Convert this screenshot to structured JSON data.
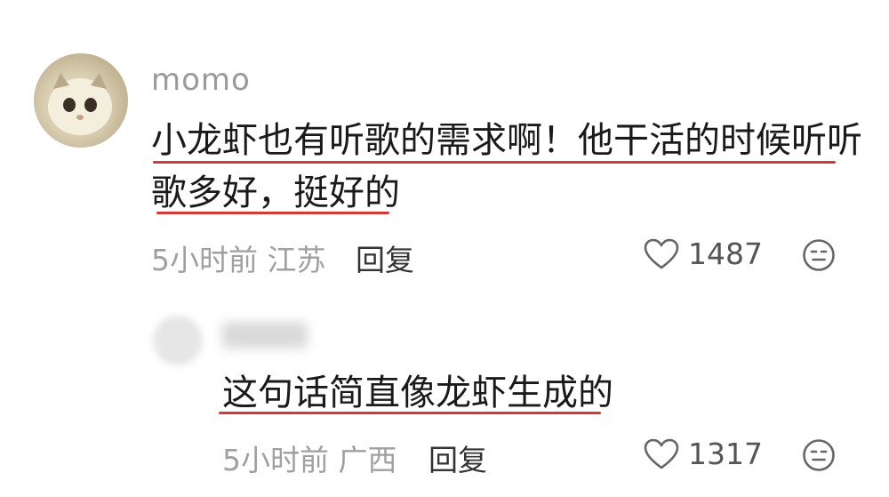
{
  "comment": {
    "username": "momo",
    "text_line1": "小龙虾也有听歌的需求啊！他干活的时候听听",
    "text_line2": "歌多好，挺好的",
    "time_location": "5小时前 江苏",
    "reply_label": "回复",
    "like_count": "1487",
    "like_icon": "heart-outline",
    "reaction_icon": "neutral-face"
  },
  "reply": {
    "text": "这句话简直像龙虾生成的",
    "time_location": "5小时前 广西",
    "reply_label": "回复",
    "like_count": "1317",
    "like_icon": "heart-outline",
    "reaction_icon": "neutral-face"
  },
  "colors": {
    "underline": "#d23a3a",
    "meta_text": "#a0a0a0"
  }
}
